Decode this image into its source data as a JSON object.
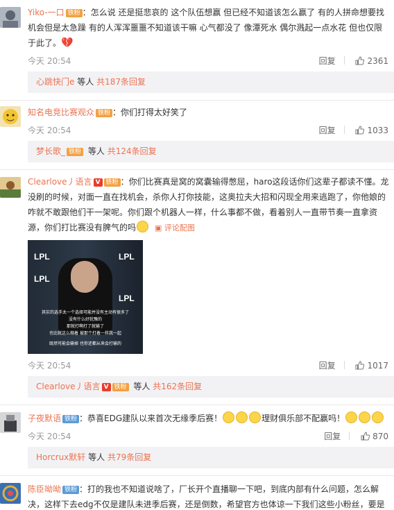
{
  "comments": [
    {
      "user": "Yiko-一口",
      "badge": "铁粉",
      "text": "怎么说 还是挺悲哀的 这个队伍想赢 但已经不知道该怎么赢了 有的人拼命想要找机会但是太急躁 有的人浑浑噩噩不知道该干嘛 心气都没了 像潭死水 偶尔溅起一点水花 但也仅限于此了。",
      "time": "今天 20:54",
      "reply": "回复",
      "likes": "2361",
      "sub": {
        "name": "心跳快门e",
        "suffix": "等人",
        "count": "共187条回复"
      }
    },
    {
      "user": "知名电竞比赛观众",
      "badge": "铁粉",
      "text": "你们打得太好笑了",
      "time": "今天 20:54",
      "reply": "回复",
      "likes": "1033",
      "sub": {
        "name": "梦长歌_",
        "suffix": "等人",
        "count": "共124条回复"
      }
    },
    {
      "user": "Clearlove丿语言",
      "badge": "铁粉",
      "text": "你们比赛真是窝的窝囊输得憋屈，haro这段话你们这辈子都读不懂。龙没刷的时候，对面一直在找机会，杀你人打你技能，这奥拉夫大招和闪现全用来逃跑了，你他娘的咋就不敢跟他们干一架呢。你们跟个机器人一样，什么事都不做，看着别人一直带节奏一直拿资源，你们打比赛没有脾气的吗",
      "img_link": "评论配图",
      "video_text": [
        "其实的选手太一个选择可能并没有主动有很多了",
        "没有什么好犹豫的",
        "那就打啊打了就输了",
        "也比就这么缩着 被那个打着一样我一起",
        "既然可能会输掉 也你还都从来会打输的"
      ],
      "time": "今天 20:54",
      "reply": "回复",
      "likes": "1017",
      "sub": {
        "name": "Clearlove丿语言",
        "suffix": "等人",
        "count": "共162条回复"
      }
    },
    {
      "user": "子夜默语",
      "badge": "铁粉",
      "text": "恭喜EDG建队以来首次无缘季后赛！",
      "text2": "理财俱乐部不配赢吗！",
      "time": "今天 20:54",
      "reply": "回复",
      "likes": "870",
      "sub": {
        "name": "Horcrux默轩",
        "suffix": "等人",
        "count": "共79条回复"
      }
    },
    {
      "user": "陈臣呦呦",
      "badge": "铁粉",
      "text": "打的我也不知道说啥了，厂长开个直播聊一下吧，到底内部有什么问题，怎么解决，这样下去edg不仅是建队未进季后赛，还是倒数，希望官方也体谅一下我们这些小粉丝，要是教练组放弃了也跟我们说一声，别让我们一场接一场生气了，你们内部有什么决策也给我们透露一"
    }
  ]
}
